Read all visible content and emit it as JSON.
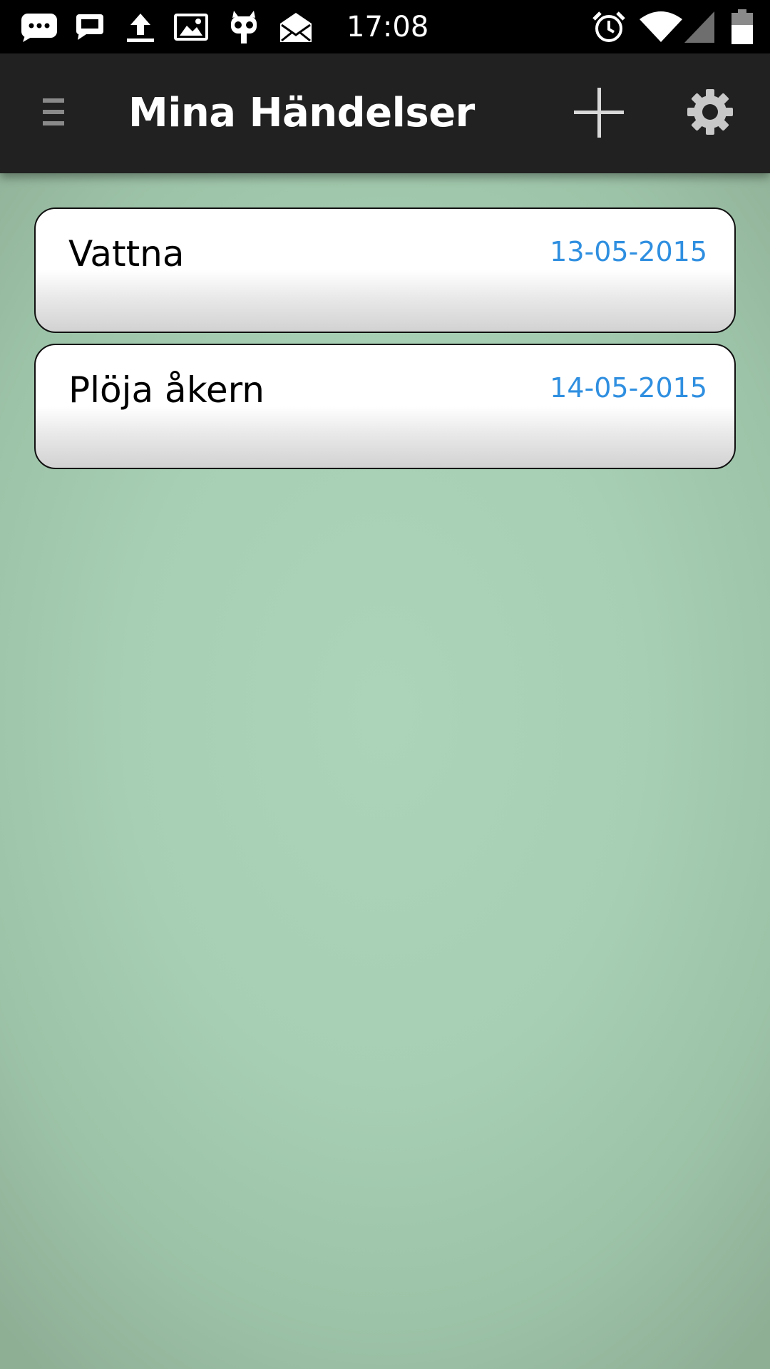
{
  "status_bar": {
    "time": "17:08",
    "left_icons": [
      "chat-bubble-icon",
      "message-icon",
      "upload-icon",
      "image-icon",
      "cyanogen-mascot-icon",
      "open-mail-icon"
    ],
    "right_icons": [
      "alarm-icon",
      "wifi-icon",
      "cell-signal-icon",
      "battery-icon"
    ]
  },
  "app_bar": {
    "title": "Mina Händelser",
    "menu_icon": "menu-icon",
    "add_icon": "plus-icon",
    "settings_icon": "gear-icon"
  },
  "events": [
    {
      "title": "Vattna",
      "date": "13-05-2015"
    },
    {
      "title": "Plöja åkern",
      "date": "14-05-2015"
    }
  ],
  "colors": {
    "status_bar": "#000000",
    "app_bar": "#212121",
    "background": "#a9d1b5",
    "date_text": "#2f8fe0",
    "card_border": "#111111"
  }
}
